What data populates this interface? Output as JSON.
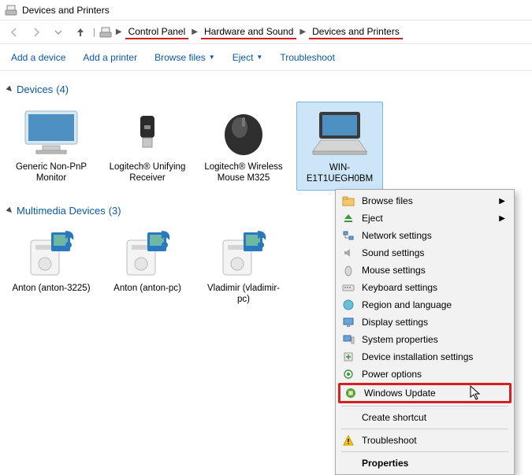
{
  "title": "Devices and Printers",
  "breadcrumb": {
    "a": "Control Panel",
    "b": "Hardware and Sound",
    "c": "Devices and Printers"
  },
  "toolbar": {
    "add_device": "Add a device",
    "add_printer": "Add a printer",
    "browse": "Browse files",
    "eject": "Eject",
    "troubleshoot": "Troubleshoot"
  },
  "groups": {
    "devices": {
      "label": "Devices",
      "count": "(4)"
    },
    "multimedia": {
      "label": "Multimedia Devices",
      "count": "(3)"
    }
  },
  "devices": [
    {
      "name": "Generic Non-PnP Monitor"
    },
    {
      "name": "Logitech® Unifying Receiver"
    },
    {
      "name": "Logitech® Wireless Mouse M325"
    },
    {
      "name": "WIN-E1T1UEGH0BM"
    }
  ],
  "multimedia": [
    {
      "name": "Anton (anton-3225)"
    },
    {
      "name": "Anton (anton-pc)"
    },
    {
      "name": "Vladimir (vladimir-pc)"
    }
  ],
  "ctx": {
    "browse": "Browse files",
    "eject": "Eject",
    "network": "Network settings",
    "sound": "Sound settings",
    "mouse": "Mouse settings",
    "keyboard": "Keyboard settings",
    "region": "Region and language",
    "display": "Display settings",
    "system": "System properties",
    "devinst": "Device installation settings",
    "power": "Power options",
    "winupd": "Windows Update",
    "shortcut": "Create shortcut",
    "troubleshoot": "Troubleshoot",
    "properties": "Properties"
  }
}
